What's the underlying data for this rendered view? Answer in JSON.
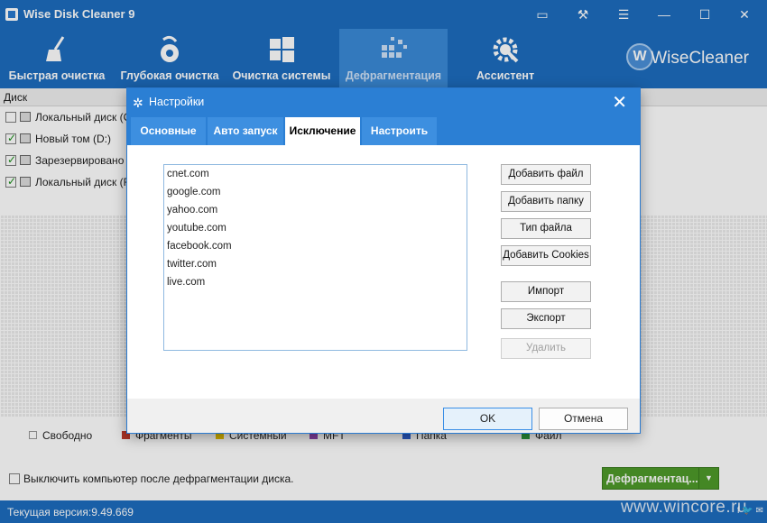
{
  "app": {
    "title": "Wise Disk Cleaner 9",
    "brand": "WiseCleaner",
    "brand_logo_letter": "W"
  },
  "toolbar": {
    "items": [
      {
        "label": "Быстрая очистка",
        "icon": "broom-icon"
      },
      {
        "label": "Глубокая очистка",
        "icon": "vacuum-icon"
      },
      {
        "label": "Очистка системы",
        "icon": "windows-icon"
      },
      {
        "label": "Дефрагментация",
        "icon": "defrag-blocks-icon",
        "active": true
      },
      {
        "label": "Ассистент",
        "icon": "gear-wrench-icon"
      }
    ]
  },
  "disks": {
    "header": "Диск",
    "items": [
      {
        "label": "Локальный диск (C",
        "checked": false
      },
      {
        "label": "Новый том (D:)",
        "checked": true
      },
      {
        "label": "Зарезервировано с",
        "checked": true
      },
      {
        "label": "Локальный диск (F",
        "checked": true
      }
    ]
  },
  "legend": {
    "items": [
      {
        "label": "Свободно",
        "color": "#ffffff"
      },
      {
        "label": "Фрагменты",
        "color": "#c0392b"
      },
      {
        "label": "Системный",
        "color": "#e5c100"
      },
      {
        "label": "MFT",
        "color": "#8e44ad"
      },
      {
        "label": "Папка",
        "color": "#2c5fd0"
      },
      {
        "label": "Файл",
        "color": "#2e9e3e"
      }
    ]
  },
  "bottom": {
    "shutdown_label": "Выключить компьютер после дефрагментации диска.",
    "defrag_button": "Дефрагментац..."
  },
  "status": {
    "version": "Текущая версия:9.49.669",
    "watermark": "www.wincore.ru"
  },
  "dialog": {
    "title": "Настройки",
    "tabs": [
      {
        "label": "Основные"
      },
      {
        "label": "Авто запуск"
      },
      {
        "label": "Исключение",
        "active": true
      },
      {
        "label": "Настроить"
      }
    ],
    "exclusions": [
      "cnet.com",
      "google.com",
      "yahoo.com",
      "youtube.com",
      "facebook.com",
      "twitter.com",
      "live.com"
    ],
    "buttons": {
      "add_file": "Добавить файл",
      "add_folder": "Добавить папку",
      "file_type": "Тип файла",
      "add_cookies": "Добавить Cookies",
      "import": "Импорт",
      "export": "Экспорт",
      "delete": "Удалить"
    },
    "ok": "OK",
    "cancel": "Отмена"
  },
  "colors": {
    "brand_blue": "#1d6dbf",
    "dialog_blue": "#2b7fd4",
    "defrag_green": "#4e9a2a"
  }
}
